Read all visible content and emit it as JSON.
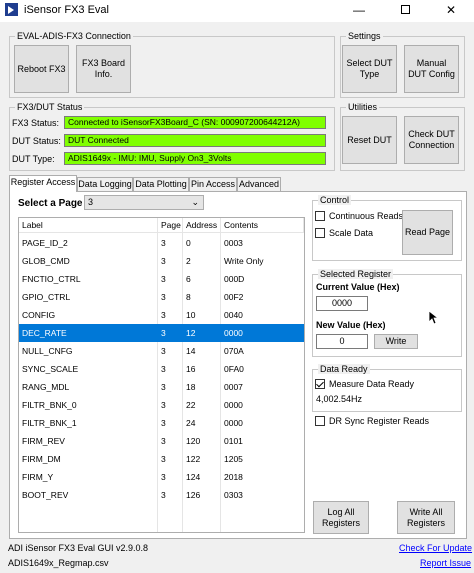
{
  "window": {
    "title": "iSensor FX3 Eval",
    "min": "—",
    "close": "✕"
  },
  "conn_group": {
    "label": "EVAL-ADIS-FX3 Connection",
    "reboot": "Reboot FX3",
    "board_info": "FX3 Board\nInfo."
  },
  "settings_group": {
    "label": "Settings",
    "select_dut": "Select DUT\nType",
    "manual_dut": "Manual\nDUT Config"
  },
  "status_group": {
    "label": "FX3/DUT Status",
    "fx3_label": "FX3 Status:",
    "fx3_value": "Connected to iSensorFX3Board_C (SN: 000907200644212A)",
    "dut_label": "DUT Status:",
    "dut_value": "DUT Connected",
    "type_label": "DUT Type:",
    "type_value": "ADIS1649x - IMU: IMU, Supply On3_3Volts",
    "status_color": "#80ff00"
  },
  "utilities_group": {
    "label": "Utilities",
    "reset_dut": "Reset DUT",
    "check_conn": "Check DUT\nConnection"
  },
  "tabs": [
    "Register Access",
    "Data Logging",
    "Data Plotting",
    "Pin Access",
    "Advanced"
  ],
  "page_select": {
    "label": "Select a Page",
    "value": "3"
  },
  "table": {
    "headers": [
      "Label",
      "Page",
      "Address",
      "Contents"
    ],
    "rows": [
      [
        "PAGE_ID_2",
        "3",
        "0",
        "0003"
      ],
      [
        "GLOB_CMD",
        "3",
        "2",
        "Write Only"
      ],
      [
        "FNCTIO_CTRL",
        "3",
        "6",
        "000D"
      ],
      [
        "GPIO_CTRL",
        "3",
        "8",
        "00F2"
      ],
      [
        "CONFIG",
        "3",
        "10",
        "0040"
      ],
      [
        "DEC_RATE",
        "3",
        "12",
        "0000"
      ],
      [
        "NULL_CNFG",
        "3",
        "14",
        "070A"
      ],
      [
        "SYNC_SCALE",
        "3",
        "16",
        "0FA0"
      ],
      [
        "RANG_MDL",
        "3",
        "18",
        "0007"
      ],
      [
        "FILTR_BNK_0",
        "3",
        "22",
        "0000"
      ],
      [
        "FILTR_BNK_1",
        "3",
        "24",
        "0000"
      ],
      [
        "FIRM_REV",
        "3",
        "120",
        "0101"
      ],
      [
        "FIRM_DM",
        "3",
        "122",
        "1205"
      ],
      [
        "FIRM_Y",
        "3",
        "124",
        "2018"
      ],
      [
        "BOOT_REV",
        "3",
        "126",
        "0303"
      ]
    ],
    "selected_row": "DEC_RATE",
    "selection_color": "#0078d7"
  },
  "control_group": {
    "label": "Control",
    "continuous": "Continuous Reads",
    "scale": "Scale Data",
    "read_page": "Read Page"
  },
  "selected_group": {
    "label": "Selected Register",
    "current_label": "Current Value (Hex)",
    "current_value": "0000",
    "new_label": "New Value (Hex)",
    "new_value": "0",
    "write": "Write"
  },
  "data_ready_group": {
    "label": "Data Ready",
    "measure": "Measure Data Ready",
    "rate": "4,002.54Hz",
    "dr_sync": "DR Sync Register Reads"
  },
  "log_all": "Log All\nRegisters",
  "write_all": "Write All\nRegisters",
  "footer": {
    "version": "ADI iSensor FX3 Eval GUI v2.9.0.8",
    "regmap": "ADIS1649x_Regmap.csv",
    "check_update": "Check For Update",
    "report_issue": "Report Issue"
  }
}
